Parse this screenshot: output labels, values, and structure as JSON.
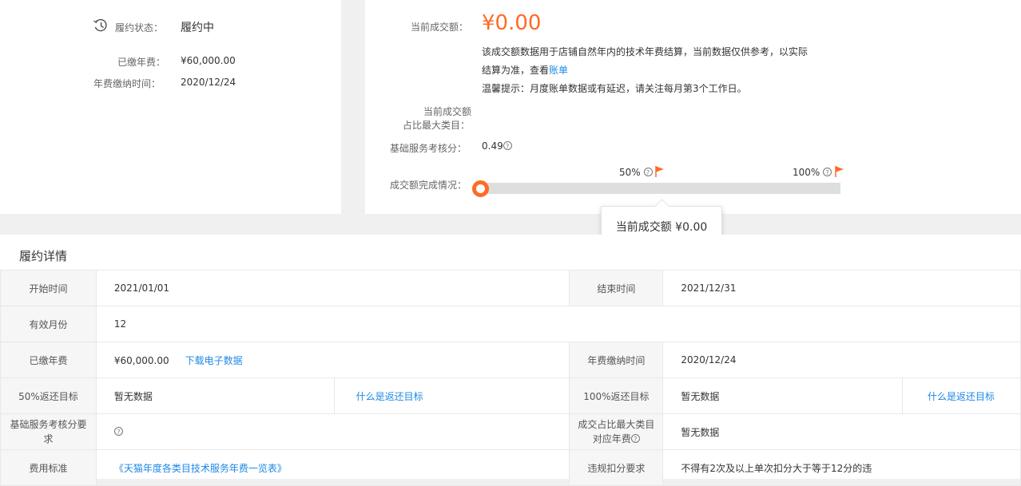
{
  "status": {
    "label": "履约状态：",
    "value": "履约中",
    "paid_fee_label": "已缴年费：",
    "paid_fee_value": "¥60,000.00",
    "pay_time_label": "年费缴纳时间：",
    "pay_time_value": "2020/12/24"
  },
  "transaction": {
    "current_label": "当前成交额：",
    "current_value": "¥0.00",
    "desc_line1": "该成交额数据用于店铺自然年内的技术年费结算，当前数据仅供参考，以实际",
    "desc_line2_prefix": "结算为准，查看",
    "desc_link": "账单",
    "tip": "温馨提示：月度账单数据或有延迟，请关注每月第3个工作日。",
    "max_category_label_1": "当前成交额",
    "max_category_label_2": "占比最大类目：",
    "service_score_label": "基础服务考核分：",
    "service_score_value": "0.49",
    "completion_label": "成交额完成情况：",
    "marker_50": "50%",
    "marker_100": "100%",
    "progress_fraction": 0,
    "tooltip": "当前成交额 ¥0.00",
    "accent_color": "#ff6a26"
  },
  "detail": {
    "title": "履约详情",
    "rows": {
      "start_label": "开始时间",
      "start_value": "2021/01/01",
      "end_label": "结束时间",
      "end_value": "2021/12/31",
      "months_label": "有效月份",
      "months_value": "12",
      "paid_label": "已缴年费",
      "paid_value": "¥60,000.00",
      "download_link": "下载电子数据",
      "pay_time_label": "年费缴纳时间",
      "pay_time_value": "2020/12/24",
      "target50_label": "50%返还目标",
      "target50_value": "暂无数据",
      "target_link_1": "什么是返还目标",
      "target100_label": "100%返还目标",
      "target100_value": "暂无数据",
      "target_link_2": "什么是返还目标",
      "score_req_label_1": "基础服务考核分要",
      "score_req_label_2": "求",
      "max_cat_label_1": "成交占比最大类目",
      "max_cat_label_2": "对应年费",
      "max_cat_value": "暂无数据",
      "fee_std_label": "费用标准",
      "fee_std_link": "《天猫年度各类目技术服务年费一览表》",
      "violation_label": "违规扣分要求",
      "violation_value": "不得有2次及以上单次扣分大于等于12分的违"
    }
  },
  "icons": {
    "history": "history-clock-icon",
    "question": "question-circle-icon",
    "flag": "flag-icon"
  }
}
